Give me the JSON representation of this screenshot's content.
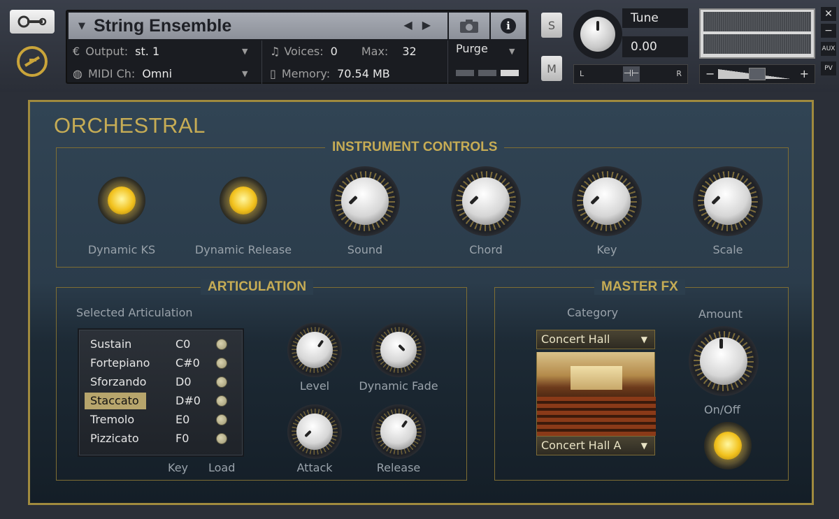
{
  "header": {
    "instrument_name": "String Ensemble",
    "output_label": "Output:",
    "output_value": "st. 1",
    "midi_label": "MIDI Ch:",
    "midi_value": "Omni",
    "voices_label": "Voices:",
    "voices_value": "0",
    "max_label": "Max:",
    "max_value": "32",
    "memory_label": "Memory:",
    "memory_value": "70.54 MB",
    "purge_label": "Purge",
    "solo_label": "S",
    "mute_label": "M",
    "tune_label": "Tune",
    "tune_value": "0.00",
    "pan_left": "L",
    "pan_right": "R",
    "aux_label": "AUX",
    "pv_label": "PV",
    "minus_label": "−",
    "vol_minus": "−",
    "vol_plus": "+"
  },
  "instrument": {
    "title": "ORCHESTRAL",
    "controls_title": "INSTRUMENT CONTROLS",
    "controls": [
      {
        "label": "Dynamic KS"
      },
      {
        "label": "Dynamic Release"
      },
      {
        "label": "Sound"
      },
      {
        "label": "Chord"
      },
      {
        "label": "Key"
      },
      {
        "label": "Scale"
      }
    ],
    "articulation_title": "ARTICULATION",
    "selected_articulation_label": "Selected Articulation",
    "articulations": [
      {
        "name": "Sustain",
        "key": "C0",
        "selected": false
      },
      {
        "name": "Fortepiano",
        "key": "C#0",
        "selected": false
      },
      {
        "name": "Sforzando",
        "key": "D0",
        "selected": false
      },
      {
        "name": "Staccato",
        "key": "D#0",
        "selected": true
      },
      {
        "name": "Tremolo",
        "key": "E0",
        "selected": false
      },
      {
        "name": "Pizzicato",
        "key": "F0",
        "selected": false
      }
    ],
    "key_col_label": "Key",
    "load_col_label": "Load",
    "artic_knobs": [
      {
        "label": "Level"
      },
      {
        "label": "Dynamic Fade"
      },
      {
        "label": "Attack"
      },
      {
        "label": "Release"
      }
    ],
    "master_fx_title": "MASTER FX",
    "category_label": "Category",
    "category_value": "Concert Hall",
    "preset_value": "Concert Hall A",
    "amount_label": "Amount",
    "onoff_label": "On/Off"
  },
  "colors": {
    "accent_gold": "#c6ac55",
    "lamp_on": "#f2c21e",
    "panel_bg": "#2b3c4b"
  },
  "icons": [
    "wrench-icon",
    "logo-icon",
    "camera-icon",
    "info-icon",
    "note-icon",
    "memory-icon",
    "midi-icon",
    "output-icon"
  ]
}
